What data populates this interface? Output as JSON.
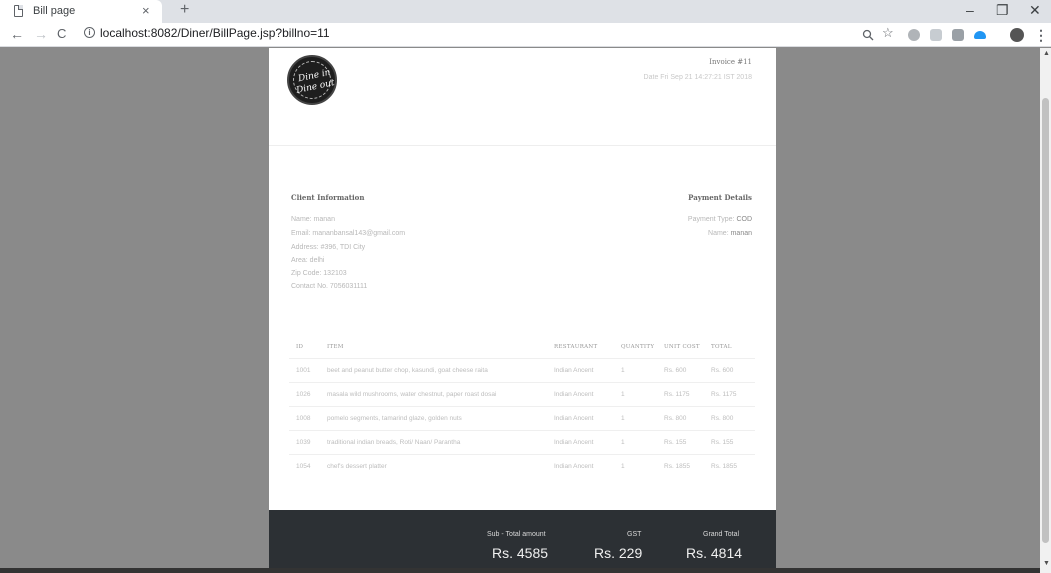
{
  "browser": {
    "tab_title": "Bill page",
    "tab_close": "×",
    "new_tab": "+",
    "url": "localhost:8082/Diner/BillPage.jsp?billno=11",
    "nav": {
      "back": "←",
      "forward": "→",
      "reload": "C"
    },
    "window": {
      "minimize": "–",
      "maximize": "❐",
      "close": "✕"
    },
    "toolbar_icons": [
      "zoom-icon",
      "star-icon",
      "extension-icon",
      "extension-icon",
      "camera-icon",
      "cloud-icon",
      "avatar",
      "menu-icon"
    ]
  },
  "invoice": {
    "logo": {
      "line1": "Dine in",
      "line2": "Dine out"
    },
    "number": "Invoice #11",
    "date": "Date Fri Sep 21 14:27:21 IST 2018",
    "client": {
      "title": "Client Information",
      "name": "Name: manan",
      "email": "Email: mananbansal143@gmail.com",
      "address": "Address: #396, TDI City",
      "area": "Area: delhi",
      "zip": "Zip Code: 132103",
      "contact": "Contact No. 7056031111"
    },
    "payment": {
      "title": "Payment Details",
      "type_label": "Payment Type: ",
      "type_value": "COD",
      "name_label": "Name: ",
      "name_value": "manan"
    },
    "table": {
      "headers": [
        "ID",
        "ITEM",
        "RESTAURANT",
        "QUANTITY",
        "UNIT COST",
        "TOTAL"
      ],
      "rows": [
        [
          "1001",
          "beet and peanut butter chop, kasundi, goat cheese raita",
          "Indian Ancent",
          "1",
          "Rs. 600",
          "Rs. 600"
        ],
        [
          "1026",
          "masala wild mushrooms, water chestnut, paper roast dosai",
          "Indian Ancent",
          "1",
          "Rs. 1175",
          "Rs. 1175"
        ],
        [
          "1008",
          "pomelo segments, tamarind glaze, golden nuts",
          "Indian Ancent",
          "1",
          "Rs. 800",
          "Rs. 800"
        ],
        [
          "1039",
          "traditional indian breads, Roti/ Naan/ Parantha",
          "Indian Ancent",
          "1",
          "Rs. 155",
          "Rs. 155"
        ],
        [
          "1054",
          "chef's dessert platter",
          "Indian Ancent",
          "1",
          "Rs. 1855",
          "Rs. 1855"
        ]
      ]
    },
    "totals": {
      "subtotal_label": "Sub - Total amount",
      "subtotal_value": "Rs. 4585",
      "gst_label": "GST",
      "gst_value": "Rs. 229",
      "grand_label": "Grand Total",
      "grand_value": "Rs. 4814"
    }
  }
}
